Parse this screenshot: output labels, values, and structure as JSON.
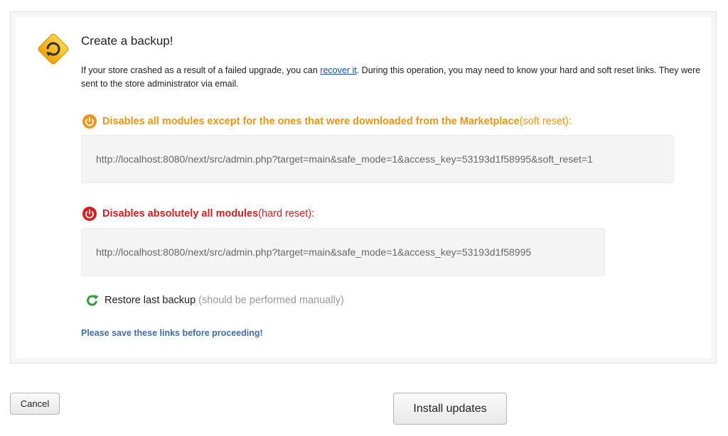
{
  "backup": {
    "title": "Create a backup!",
    "intro_before": "If your store crashed as a result of a failed upgrade, you can ",
    "intro_link": "recover it",
    "intro_after": ". During this operation, you may need to know your hard and soft reset links. They were sent to the store administrator via email.",
    "soft_reset": {
      "label_strong": "Disables all modules except for the ones that were downloaded from the Marketplace",
      "label_suffix": " (soft reset):",
      "url": "http://localhost:8080/next/src/admin.php?target=main&safe_mode=1&access_key=53193d1f58995&soft_reset=1",
      "color": "#e8961c"
    },
    "hard_reset": {
      "label_strong": "Disables absolutely all modules",
      "label_suffix": " (hard reset):",
      "url": "http://localhost:8080/next/src/admin.php?target=main&safe_mode=1&access_key=53193d1f58995",
      "color": "#d21f1f"
    },
    "restore": {
      "label": "Restore last backup",
      "note": "(should be performed manually)"
    },
    "save_note": "Please save these links before proceeding!"
  },
  "icons": {
    "warning": "warning-backup-icon",
    "soft": "power-orange-icon",
    "hard": "power-red-icon",
    "restore": "restore-arrow-icon"
  },
  "buttons": {
    "cancel": "Cancel",
    "install": "Install updates"
  }
}
